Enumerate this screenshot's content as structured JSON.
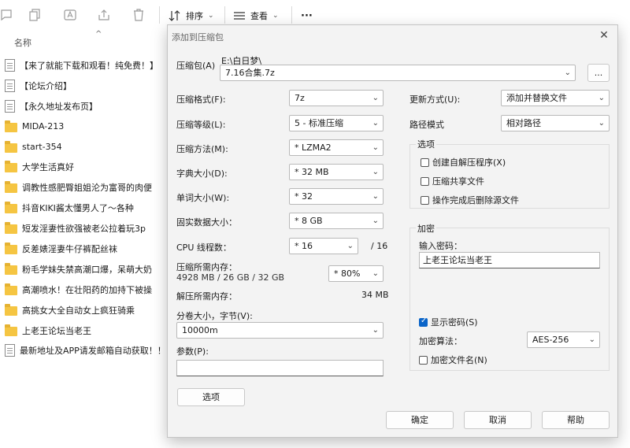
{
  "explorer": {
    "toolbar": {
      "sort_label": "排序",
      "view_label": "查看",
      "more_label": "···"
    },
    "column_name": "名称",
    "files": [
      {
        "type": "doc",
        "name": "【来了就能下载和观看！纯免费！】"
      },
      {
        "type": "doc",
        "name": "【论坛介绍】"
      },
      {
        "type": "doc",
        "name": "【永久地址发布页】"
      },
      {
        "type": "folder",
        "name": "MIDA-213"
      },
      {
        "type": "folder",
        "name": "start-354"
      },
      {
        "type": "folder",
        "name": "大学生活真好"
      },
      {
        "type": "folder",
        "name": "调教性感肥臀姐姐沦为富哥的肉便"
      },
      {
        "type": "folder",
        "name": "抖音KIKI酱太懂男人了～各种"
      },
      {
        "type": "folder",
        "name": "短发淫妻性欲强被老公拉着玩3p"
      },
      {
        "type": "folder",
        "name": "反差婊淫妻牛仔裤配丝袜"
      },
      {
        "type": "folder",
        "name": "粉毛学妹失禁高潮口爆，呆萌大奶"
      },
      {
        "type": "folder",
        "name": "高潮喷水！在壮阳药的加持下被操"
      },
      {
        "type": "folder",
        "name": "高挑女大全自动女上疯狂骑乘"
      },
      {
        "type": "folder",
        "name": "上老王论坛当老王"
      },
      {
        "type": "doc",
        "name": "最新地址及APP请发邮箱自动获取！！"
      }
    ]
  },
  "dialog": {
    "title": "添加到压缩包",
    "archive_label": "压缩包(A)",
    "archive_path": "E:\\白日梦\\",
    "archive_name": "7.16合集.7z",
    "browse_label": "...",
    "format_label": "压缩格式(F):",
    "format_value": "7z",
    "level_label": "压缩等级(L):",
    "level_value": "5 - 标准压缩",
    "method_label": "压缩方法(M):",
    "method_value": "* LZMA2",
    "dict_label": "字典大小(D):",
    "dict_value": "* 32 MB",
    "word_label": "单词大小(W):",
    "word_value": "* 32",
    "solid_label": "固实数据大小：",
    "solid_value": "* 8 GB",
    "cpu_label": "CPU 线程数：",
    "cpu_value": "* 16",
    "cpu_max": "/ 16",
    "mem_label": "压缩所需内存：",
    "mem_detail": "4928 MB / 26 GB / 32 GB",
    "mem_pct": "* 80%",
    "decomp_label": "解压所需内存：",
    "decomp_value": "34 MB",
    "split_label": "分卷大小，字节(V):",
    "split_value": "10000m",
    "params_label": "参数(P):",
    "params_value": "",
    "options_button": "选项",
    "update_label": "更新方式(U):",
    "update_value": "添加并替换文件",
    "path_label": "路径模式",
    "path_value": "相对路径",
    "options_group": "选项",
    "opt_sfx": "创建自解压程序(X)",
    "opt_shared": "压缩共享文件",
    "opt_delete": "操作完成后删除源文件",
    "encrypt_group": "加密",
    "password_label": "输入密码：",
    "password_value": "上老王论坛当老王",
    "show_password": "显示密码(S)",
    "enc_method_label": "加密算法：",
    "enc_method_value": "AES-256",
    "encrypt_names": "加密文件名(N)",
    "ok_button": "确定",
    "cancel_button": "取消",
    "help_button": "帮助"
  }
}
